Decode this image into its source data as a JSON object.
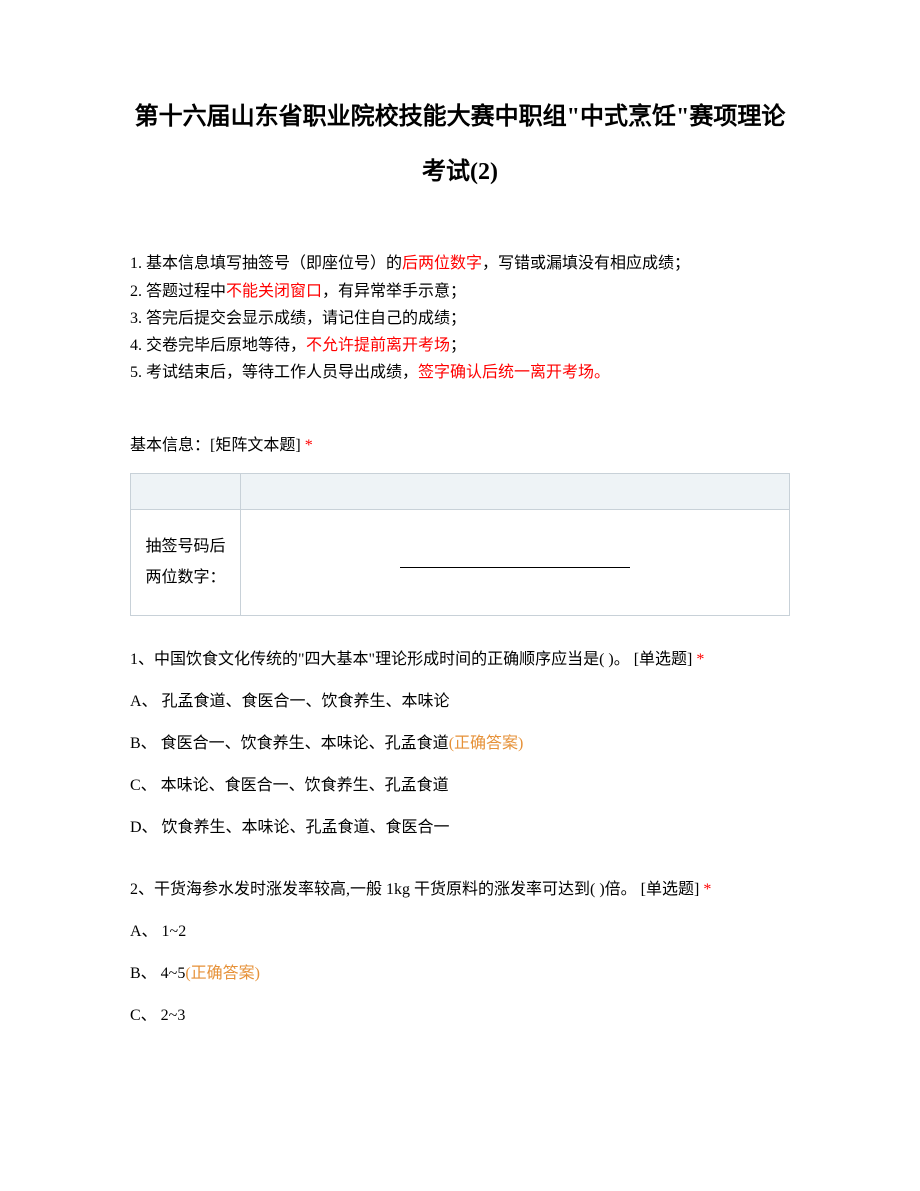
{
  "title": "第十六届山东省职业院校技能大赛中职组\"中式烹饪\"赛项理论考试(2)",
  "instructions": {
    "i1_a": "1.  基本信息填写抽签号（即座位号）的",
    "i1_b": "后两位数字",
    "i1_c": "，写错或漏填没有相应成绩；",
    "i2_a": "2.  答题过程中",
    "i2_b": "不能关闭窗口",
    "i2_c": "，有异常举手示意；",
    "i3": "3.  答完后提交会显示成绩，请记住自己的成绩；",
    "i4_a": "4.  交卷完毕后原地等待，",
    "i4_b": "不允许提前离开考场",
    "i4_c": "；",
    "i5_a": "5.  考试结束后，等待工作人员导出成绩，",
    "i5_b": "签字确认后统一离开考场。"
  },
  "matrix": {
    "label_a": "基本信息：",
    "label_b": "[矩阵文本题]",
    "row_label": "抽签号码后两位数字："
  },
  "asterisk": " *",
  "correct_answer": "(正确答案)",
  "q1": {
    "stem": "1、中国饮食文化传统的\"四大基本\"理论形成时间的正确顺序应当是( )。 [单选题]",
    "A": "A、 孔孟食道、食医合一、饮食养生、本味论",
    "B": "B、 食医合一、饮食养生、本味论、孔孟食道",
    "C": "C、 本味论、食医合一、饮食养生、孔孟食道",
    "D": "D、 饮食养生、本味论、孔孟食道、食医合一"
  },
  "q2": {
    "stem": "2、干货海参水发时涨发率较高,一般 1kg 干货原料的涨发率可达到( )倍。 [单选题]",
    "A": "A、 1~2",
    "B": "B、 4~5",
    "C": "C、 2~3"
  }
}
